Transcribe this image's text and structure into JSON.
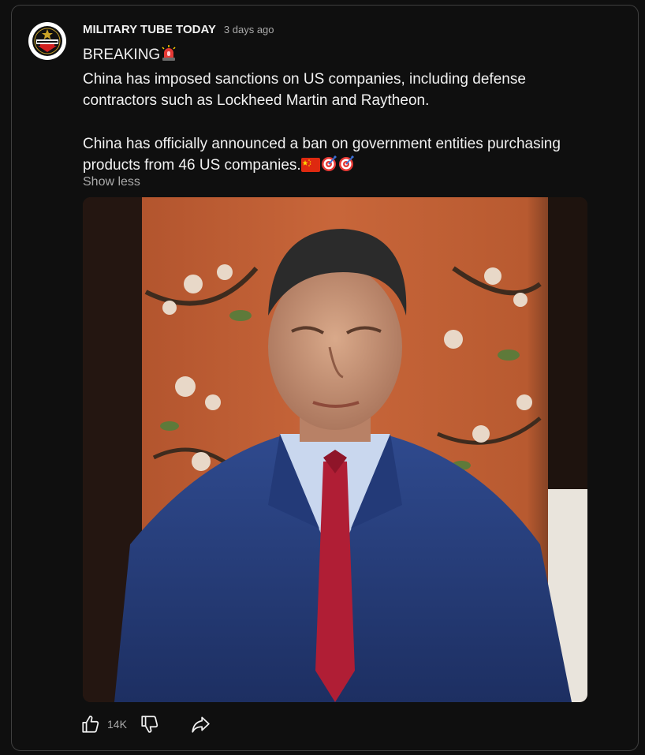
{
  "post": {
    "channel_name": "MILITARY TUBE TODAY",
    "time_ago": "3 days ago",
    "line_breaking": "BREAKING",
    "paragraph_1": "China has imposed sanctions on US companies, including defense contractors such as Lockheed Martin and Raytheon.",
    "paragraph_2": "China has officially announced a ban on government entities purchasing products from 46 US companies.",
    "show_less_label": "Show less",
    "avatar_icon": "channel-logo-icon",
    "image_alt": "Man in blue suit and red tie seated before a floral screen"
  },
  "actions": {
    "like_count": "14K",
    "like_icon": "thumbs-up-icon",
    "dislike_icon": "thumbs-down-icon",
    "share_icon": "share-icon"
  },
  "colors": {
    "background": "#0f0f0f",
    "border": "#3f3f3f",
    "text_primary": "#f1f1f1",
    "text_secondary": "#aaaaaa",
    "logo_red": "#d32020"
  }
}
